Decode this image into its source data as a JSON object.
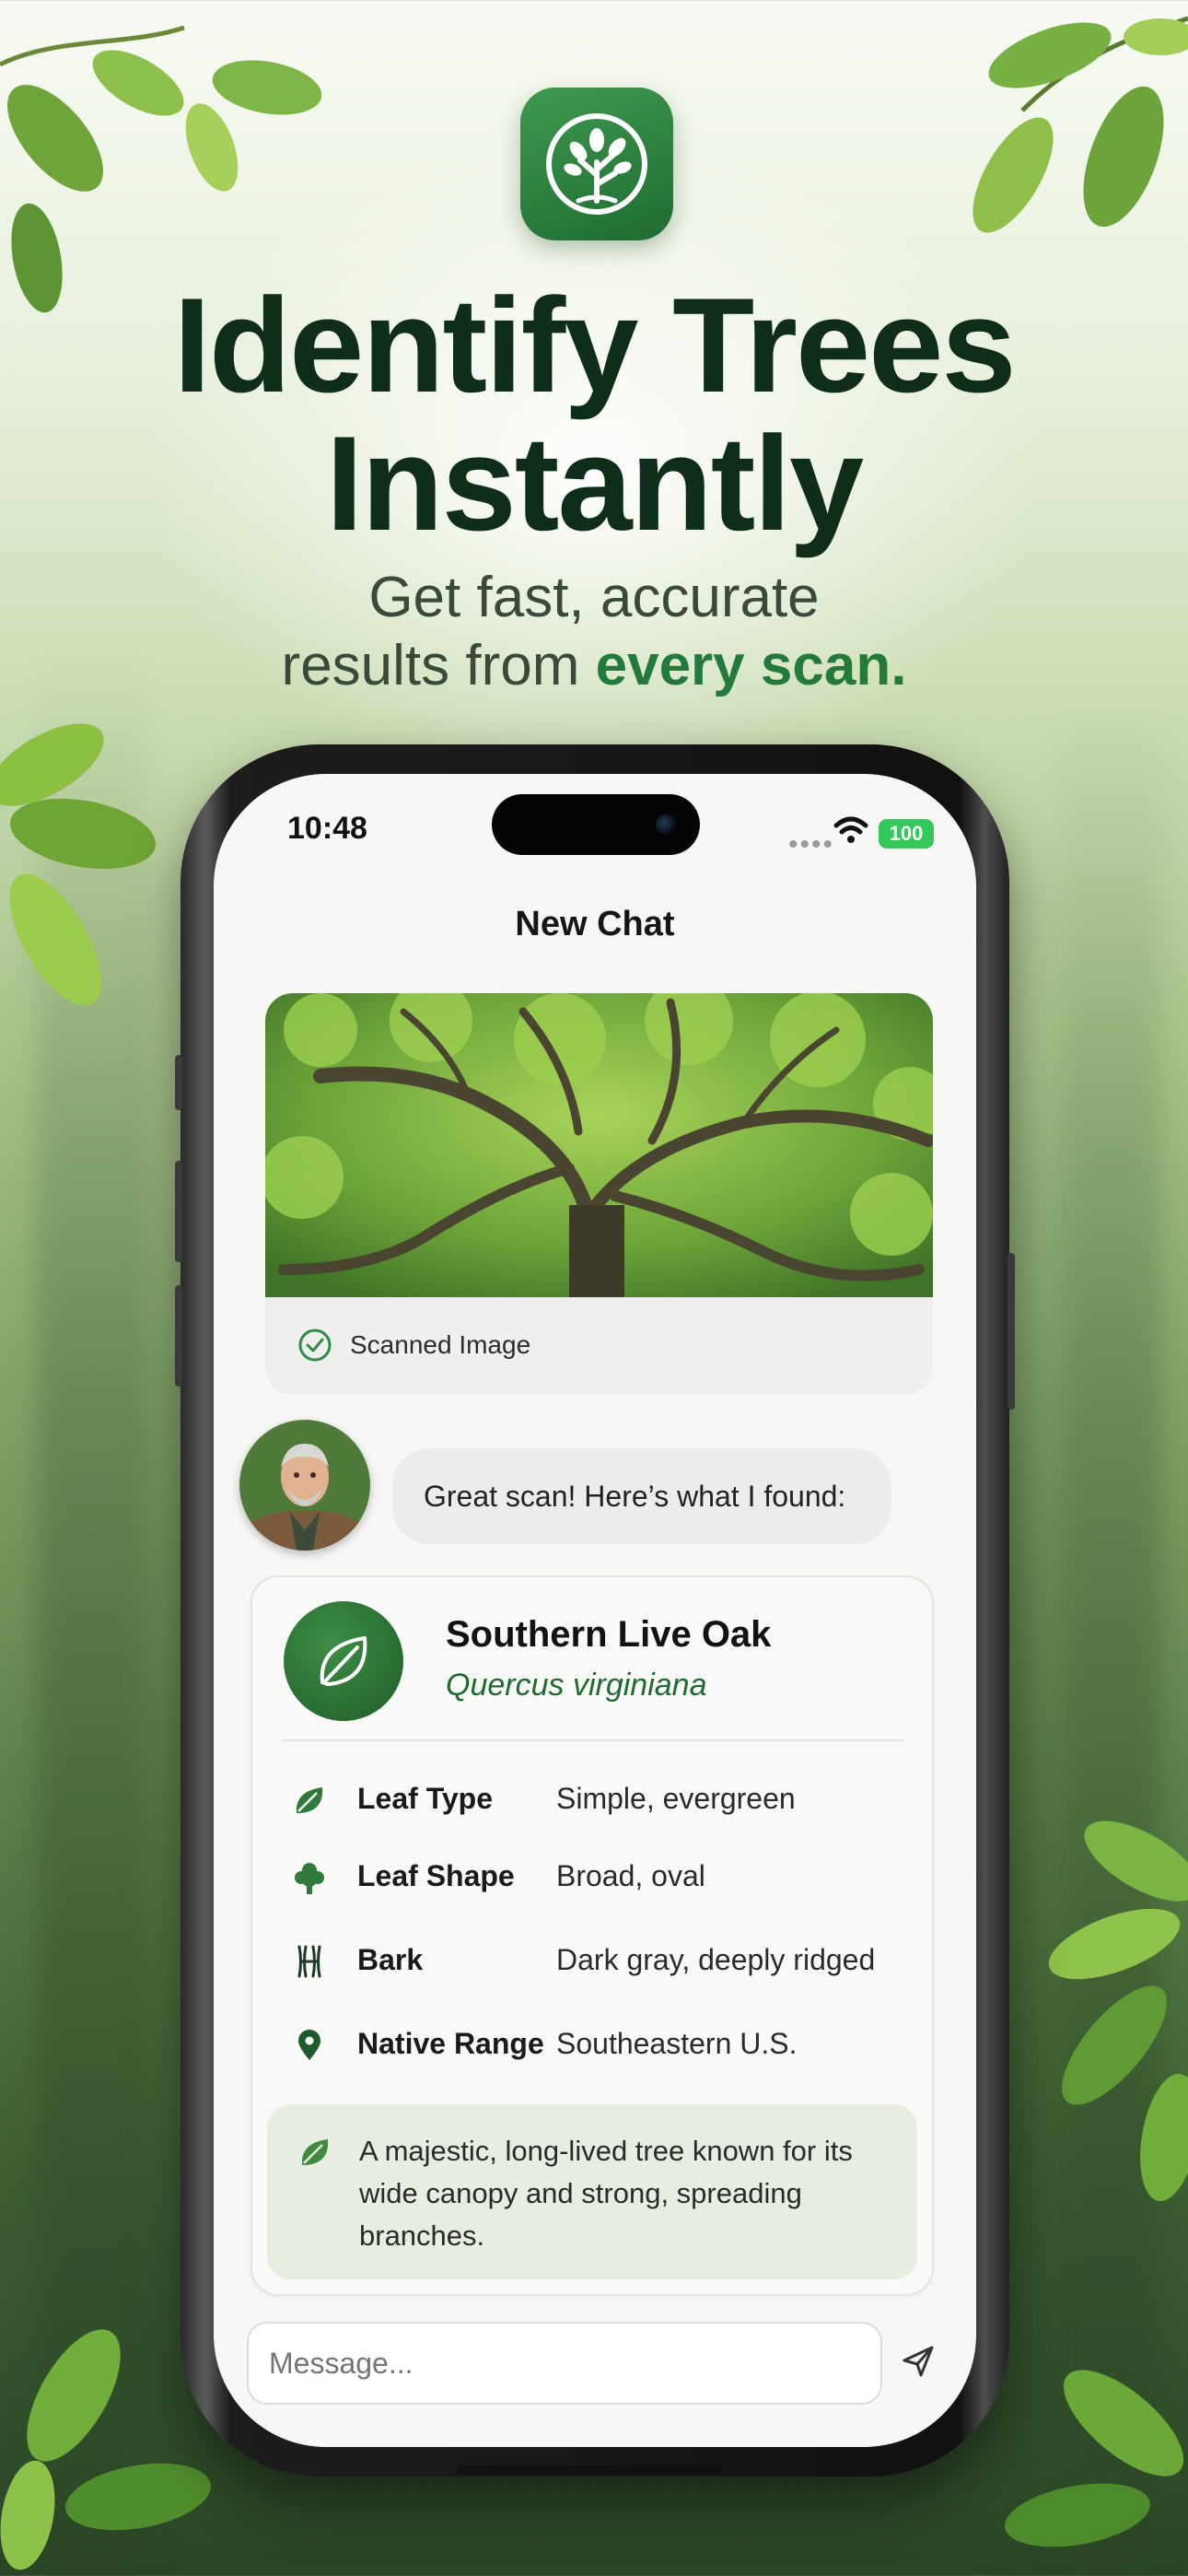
{
  "headline": {
    "line1": "Identify Trees",
    "line2": "Instantly",
    "sub_line1": "Get fast, accurate",
    "sub_line2_plain": "results from ",
    "sub_line2_accent": "every scan."
  },
  "status_bar": {
    "time": "10:48",
    "signal": "••••",
    "battery": "100"
  },
  "chat": {
    "title": "New Chat",
    "scanned_label": "Scanned Image",
    "assistant_message": "Great scan! Here’s what I found:"
  },
  "result": {
    "common_name": "Southern Live Oak",
    "scientific_name": "Quercus virginiana",
    "attributes": [
      {
        "icon": "leaf-icon",
        "label": "Leaf Type",
        "value": "Simple, evergreen"
      },
      {
        "icon": "tree-icon",
        "label": "Leaf Shape",
        "value": "Broad, oval"
      },
      {
        "icon": "bark-icon",
        "label": "Bark",
        "value": "Dark gray, deeply ridged"
      },
      {
        "icon": "location-pin-icon",
        "label": "Native Range",
        "value": "Southeastern U.S."
      }
    ],
    "description": "A majestic, long-lived tree known for its wide canopy and strong, spreading branches."
  },
  "composer": {
    "placeholder": "Message..."
  },
  "colors": {
    "accent_green": "#237a3b",
    "headline_dark": "#0e2d1a",
    "battery_green": "#34c759"
  }
}
